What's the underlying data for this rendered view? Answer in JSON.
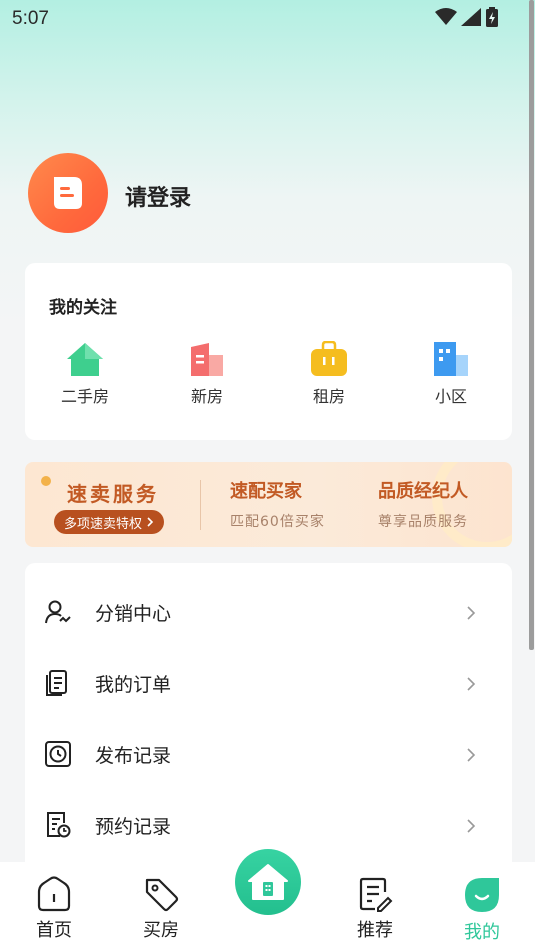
{
  "status_bar": {
    "time": "5:07"
  },
  "profile": {
    "login_text": "请登录"
  },
  "follow": {
    "title": "我的关注",
    "items": [
      {
        "label": "二手房",
        "icon": "house-icon",
        "color": "#3ecf8e"
      },
      {
        "label": "新房",
        "icon": "building-icon",
        "color": "#f46d6d"
      },
      {
        "label": "租房",
        "icon": "suitcase-icon",
        "color": "#f5bd1f"
      },
      {
        "label": "小区",
        "icon": "community-icon",
        "color": "#3d9af0"
      }
    ]
  },
  "banner": {
    "sell_title": "速卖服务",
    "sell_pill": "多项速卖特权",
    "match_title": "速配买家",
    "match_sub": "匹配60倍买家",
    "agent_title": "品质经纪人",
    "agent_sub": "尊享品质服务"
  },
  "menu": {
    "items": [
      {
        "label": "分销中心",
        "icon": "user-share-icon"
      },
      {
        "label": "我的订单",
        "icon": "order-list-icon"
      },
      {
        "label": "发布记录",
        "icon": "clock-record-icon"
      },
      {
        "label": "预约记录",
        "icon": "appointment-icon"
      }
    ]
  },
  "tabs": {
    "items": [
      {
        "label": "首页",
        "icon": "home-tab-icon"
      },
      {
        "label": "买房",
        "icon": "tag-icon"
      },
      {
        "label": "推荐",
        "icon": "recommend-icon"
      },
      {
        "label": "我的",
        "icon": "smile-icon",
        "active": true
      }
    ],
    "center_icon": "house-center-icon",
    "active_color": "#2fc79a"
  }
}
